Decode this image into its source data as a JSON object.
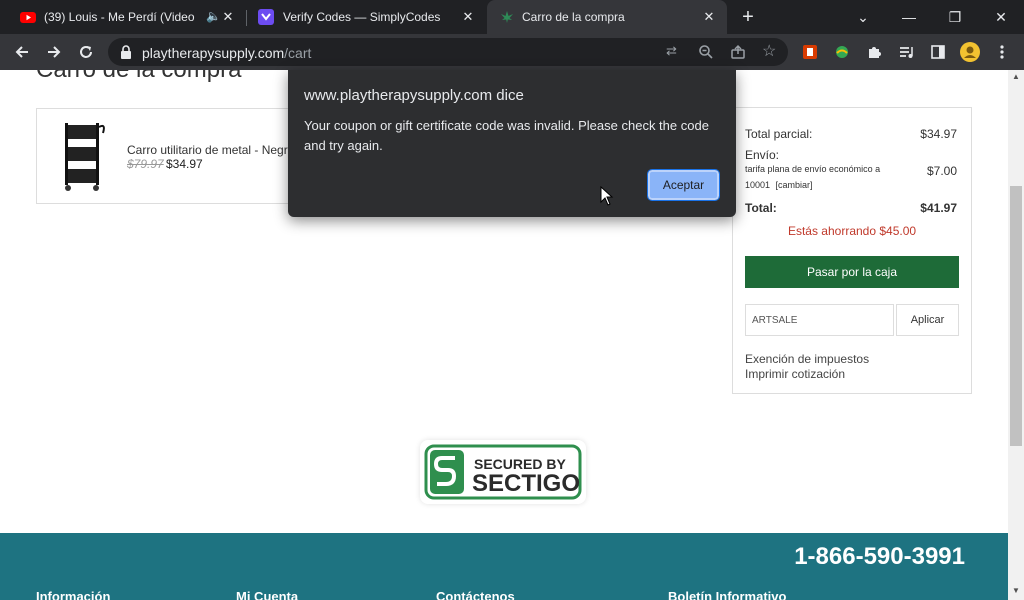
{
  "browser": {
    "tabs": [
      {
        "title": "(39) Louis - Me Perdí (Video O",
        "icon": "youtube-icon",
        "muted_icon": "speaker-icon",
        "close": "✕"
      },
      {
        "title": "Verify Codes — SimplyCodes",
        "icon": "simplycodes-icon",
        "close": "✕"
      },
      {
        "title": "Carro de la compra",
        "icon": "cannabis-leaf-icon",
        "close": "✕",
        "active": true
      }
    ],
    "new_tab": "+",
    "url_host": "playtherapysupply.com",
    "url_path": "/cart"
  },
  "page": {
    "heading": "Carro de la compra",
    "item": {
      "name": "Carro utilitario de metal - Negro",
      "old_price": "$79.97",
      "price": "$34.97"
    },
    "summary": {
      "subtotal_label": "Total parcial:",
      "subtotal_value": "$34.97",
      "shipping_label": "Envío:",
      "shipping_desc": "tarifa plana de envío económico a",
      "shipping_value": "$7.00",
      "shipping_zip": "10001",
      "shipping_change": "[cambiar]",
      "total_label": "Total:",
      "total_value": "$41.97",
      "savings": "Estás ahorrando $45.00",
      "checkout": "Pasar por la caja",
      "coupon_value": "ARTSALE",
      "apply": "Aplicar",
      "tax_exempt": "Exención de impuestos",
      "print_quote": "Imprimir cotización"
    },
    "seal": {
      "line1": "SECURED BY",
      "line2": "SECTIGO"
    },
    "footer": {
      "phone": "1-866-590-3991",
      "columns": [
        "Información",
        "Mi Cuenta",
        "Contáctenos",
        "Boletín Informativo"
      ]
    }
  },
  "dialog": {
    "title": "www.playtherapysupply.com dice",
    "message": "Your coupon or gift certificate code was invalid. Please check the code and try again.",
    "ok": "Aceptar"
  },
  "colors": {
    "checkout_green": "#1e6b38",
    "footer_teal": "#1e7381",
    "savings_red": "#c0392b",
    "dialog_button": "#8ab4f8"
  }
}
